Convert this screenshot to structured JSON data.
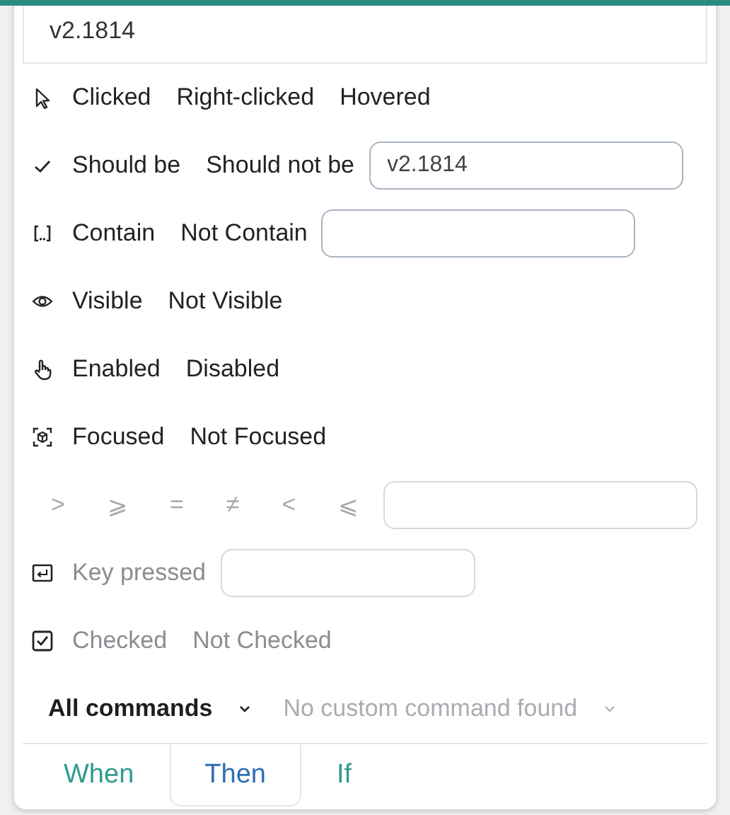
{
  "top_field": {
    "value": "v2.1814"
  },
  "rows": [
    {
      "kind": "cursor",
      "disabled": false,
      "options": [
        "Clicked",
        "Right-clicked",
        "Hovered"
      ]
    },
    {
      "kind": "check",
      "disabled": false,
      "options": [
        "Should be",
        "Should not be"
      ],
      "field": {
        "value": "v2.1814"
      }
    },
    {
      "kind": "brackets",
      "disabled": false,
      "options": [
        "Contain",
        "Not Contain"
      ],
      "field": {
        "kind": "text"
      }
    },
    {
      "kind": "eye",
      "disabled": false,
      "options": [
        "Visible",
        "Not Visible"
      ]
    },
    {
      "kind": "hand",
      "disabled": false,
      "options": [
        "Enabled",
        "Disabled"
      ]
    },
    {
      "kind": "focus",
      "disabled": false,
      "options": [
        "Focused",
        "Not Focused"
      ]
    },
    {
      "kind": "operators",
      "disabled": true,
      "options": [
        ">",
        "⩾",
        "=",
        "≠",
        "<",
        "⩽"
      ],
      "field": {
        "kind": "text"
      }
    },
    {
      "kind": "enter-key",
      "disabled": true,
      "options": [
        "Key pressed"
      ],
      "field": {
        "kind": "short"
      }
    },
    {
      "kind": "checkbox",
      "disabled": true,
      "options": [
        "Checked",
        "Not Checked"
      ]
    }
  ],
  "dropdowns": [
    {
      "label": "All commands",
      "disabled": false
    },
    {
      "label": "No custom command found",
      "disabled": true
    }
  ],
  "tabs": [
    {
      "label": "When",
      "selected": false
    },
    {
      "label": "Then",
      "selected": true
    },
    {
      "label": "If",
      "selected": false
    }
  ]
}
